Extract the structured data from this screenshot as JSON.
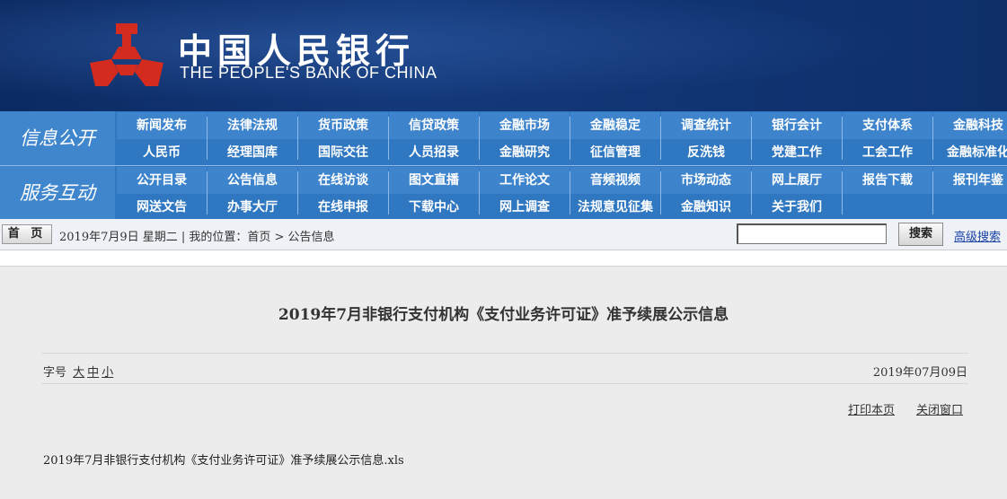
{
  "header": {
    "name_cn": "中国人民银行",
    "name_en": "THE PEOPLE'S BANK OF CHINA",
    "logo_color": "#d32b1e",
    "banner_color": "#0e2f6a"
  },
  "nav": {
    "section1_label": "信息公开",
    "section2_label": "服务互动",
    "row1": [
      "新闻发布",
      "法律法规",
      "货币政策",
      "信贷政策",
      "金融市场",
      "金融稳定",
      "调查统计",
      "银行会计",
      "支付体系",
      "金融科技"
    ],
    "row2": [
      "人民币",
      "经理国库",
      "国际交往",
      "人员招录",
      "金融研究",
      "征信管理",
      "反洗钱",
      "党建工作",
      "工会工作",
      "金融标准化"
    ],
    "row3": [
      "公开目录",
      "公告信息",
      "在线访谈",
      "图文直播",
      "工作论文",
      "音频视频",
      "市场动态",
      "网上展厅",
      "报告下载",
      "报刊年鉴"
    ],
    "row4": [
      "网送文告",
      "办事大厅",
      "在线申报",
      "下载中心",
      "网上调查",
      "法规意见征集",
      "金融知识",
      "关于我们"
    ]
  },
  "breadcrumb": {
    "home_label": "首 页",
    "text": "2019年7月9日 星期二 | 我的位置：首页 > 公告信息",
    "search_value": "",
    "search_button": "搜索",
    "advanced_search": "高级搜索"
  },
  "article": {
    "title": "2019年7月非银行支付机构《支付业务许可证》准予续展公示信息",
    "font_size_label": "字号",
    "font_size_options": [
      "大",
      "中",
      "小"
    ],
    "date": "2019年07月09日",
    "print_label": "打印本页",
    "close_label": "关闭窗口",
    "attachment": "2019年7月非银行支付机构《支付业务许可证》准予续展公示信息.xls"
  }
}
